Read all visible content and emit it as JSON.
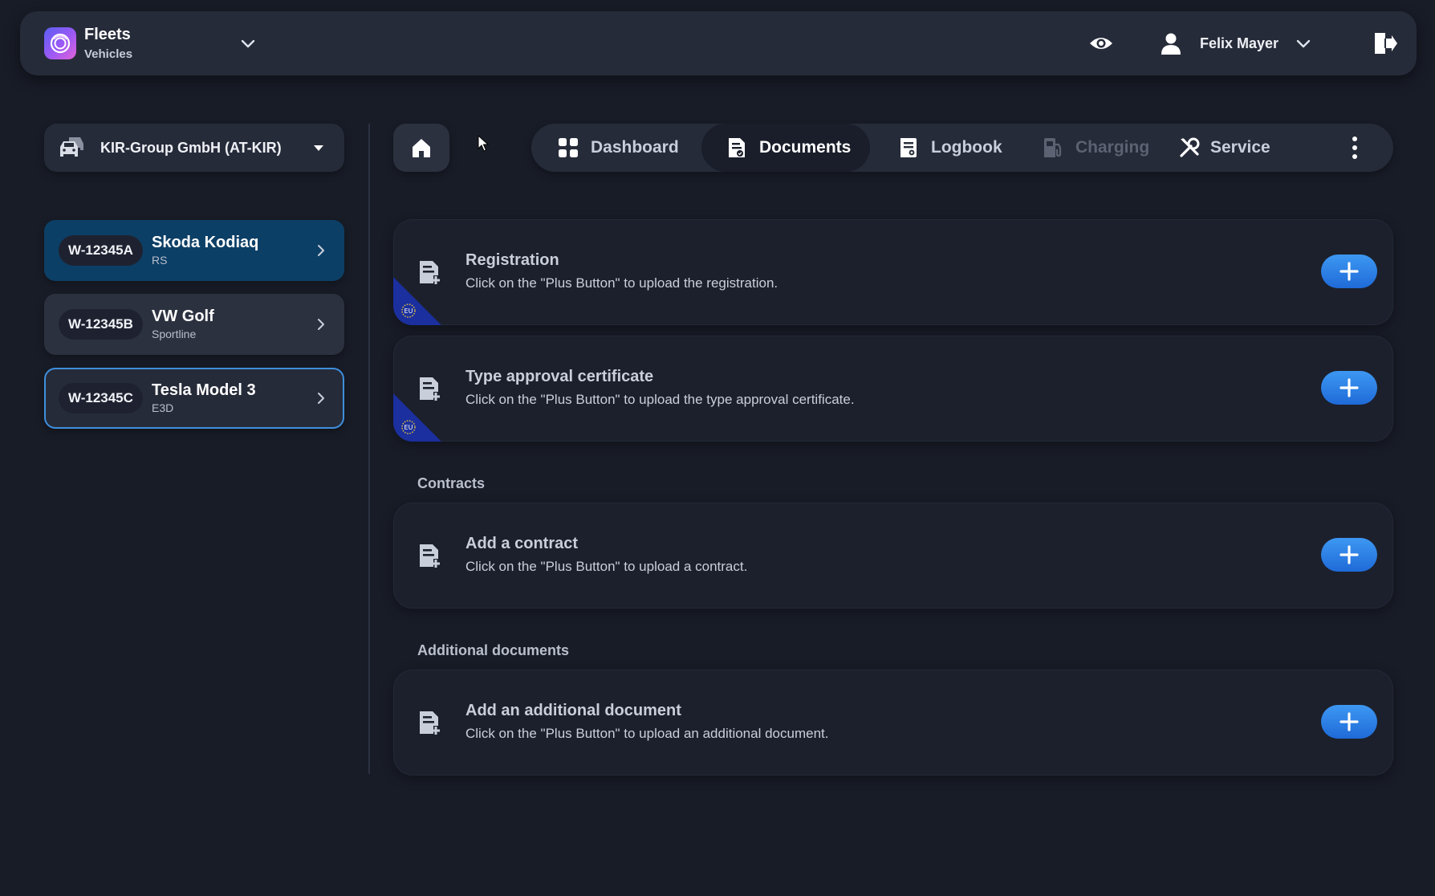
{
  "app": {
    "title": "Fleets",
    "subtitle": "Vehicles"
  },
  "user": {
    "name": "Felix Mayer"
  },
  "company": {
    "label": "KIR-Group GmbH (AT-KIR)"
  },
  "vehicles": [
    {
      "plate": "W-12345A",
      "name": "Skoda Kodiaq",
      "variant": "RS",
      "state": "selected"
    },
    {
      "plate": "W-12345B",
      "name": "VW Golf",
      "variant": "Sportline",
      "state": "default"
    },
    {
      "plate": "W-12345C",
      "name": "Tesla Model 3",
      "variant": "E3D",
      "state": "focused"
    }
  ],
  "tabs": [
    {
      "label": "Dashboard",
      "icon": "grid-icon",
      "state": "default"
    },
    {
      "label": "Documents",
      "icon": "document-icon",
      "state": "active"
    },
    {
      "label": "Logbook",
      "icon": "logbook-icon",
      "state": "default"
    },
    {
      "label": "Charging",
      "icon": "fuel-pump-icon",
      "state": "disabled"
    },
    {
      "label": "Service",
      "icon": "tools-icon",
      "state": "default"
    }
  ],
  "documents": {
    "registration": {
      "title": "Registration",
      "description": "Click on the \"Plus Button\" to upload the registration.",
      "badge": "EU"
    },
    "type_approval": {
      "title": "Type approval certificate",
      "description": "Click on the \"Plus Button\" to upload the type approval certificate.",
      "badge": "EU"
    },
    "contracts": {
      "section_title": "Contracts",
      "title": "Add a contract",
      "description": "Click on the \"Plus Button\" to upload a contract."
    },
    "additional": {
      "section_title": "Additional documents",
      "title": "Add an additional document",
      "description": "Click on the \"Plus Button\" to upload an additional document."
    }
  },
  "colors": {
    "background": "#181c27",
    "surface": "#262b39",
    "card": "#1c202c",
    "accent": "#2a82e8",
    "selected_vehicle": "#0c3f66",
    "focus_outline": "#3f8fdd",
    "eu_blue": "#1b2f9e"
  }
}
